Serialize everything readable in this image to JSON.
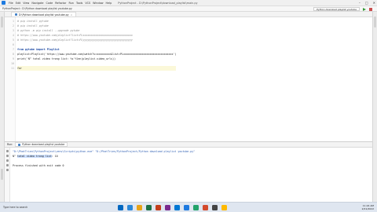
{
  "titlebar": {
    "menu": [
      "File",
      "Edit",
      "View",
      "Navigate",
      "Code",
      "Refactor",
      "Run",
      "Tools",
      "VCS",
      "Window",
      "Help"
    ],
    "project_title": "PythonProject - D:\\PythonProject\\download_playlist\\main.py"
  },
  "navbar": {
    "breadcrumb": "PythonProject  ›  D:\\Python download playlist youtube.py",
    "run_config": "Python download playlist youtube"
  },
  "editor": {
    "tab_label": "D:\\Python download playlist youtube.py",
    "lines": [
      {
        "n": "1",
        "kind": "comment",
        "text": "# pip install pytube"
      },
      {
        "n": "2",
        "kind": "comment",
        "text": "# pip install pytube"
      },
      {
        "n": "3",
        "kind": "comment",
        "text": "# python -m pip install --upgrade pytube"
      },
      {
        "n": "4",
        "kind": "comment",
        "text": "# https://www.youtube.com/playlist?list=PLxxxxxxxxxxxxxxxxxxxxxxxxxxxxxxxx"
      },
      {
        "n": "5",
        "kind": "comment",
        "text": "# https://www.youtube.com/playlist?list=PLyyyyyyyyyyyyyyyyyyyyyyyyyyyyyyyy"
      },
      {
        "n": "6",
        "kind": "blank",
        "text": ""
      },
      {
        "n": "7",
        "kind": "import",
        "text": "from pytube import Playlist"
      },
      {
        "n": "8",
        "kind": "default",
        "text": "playlist=Playlist('https://www.youtube.com/watch?v=xxxxxxxxx&list=PLxxxxxxxxxxxxxxxxxxxxxxxxxxxxxxxx')"
      },
      {
        "n": "9",
        "kind": "default",
        "text": "print('N° total video trong list: %s'%len(playlist.video_urls))"
      },
      {
        "n": "10",
        "kind": "blank",
        "text": ""
      },
      {
        "n": "11",
        "kind": "default",
        "text": "for"
      }
    ]
  },
  "run_panel": {
    "label": "Run:",
    "tab": "Python download playlist youtube",
    "console": [
      "\"D:\\PhatTrien\\PythonProject\\venv\\Scripts\\python.exe\" \"D:/PhatTrien/PythonProject/Python download playlist youtube.py\"",
      "N° total video trong list: 10",
      "",
      "Process finished with exit code 0"
    ],
    "selected_text": "total video trong list"
  },
  "statusbar": {
    "left": "Python Packages   Python Console   Terminal   Run   TODO   Problems",
    "right": [
      "Python 3.9 (PythonProject)"
    ]
  },
  "taskbar": {
    "left": "Type here to search",
    "time": "11:24 AM",
    "date": "2/21/2022",
    "icon_colors": [
      "#0067c0",
      "#2b88d8",
      "#e8a317",
      "#1e7145",
      "#c43e1c",
      "#7a2a8f",
      "#0078d4",
      "#1d7ae0",
      "#22a36a",
      "#d34a2d",
      "#444444",
      "#ffb900"
    ]
  }
}
